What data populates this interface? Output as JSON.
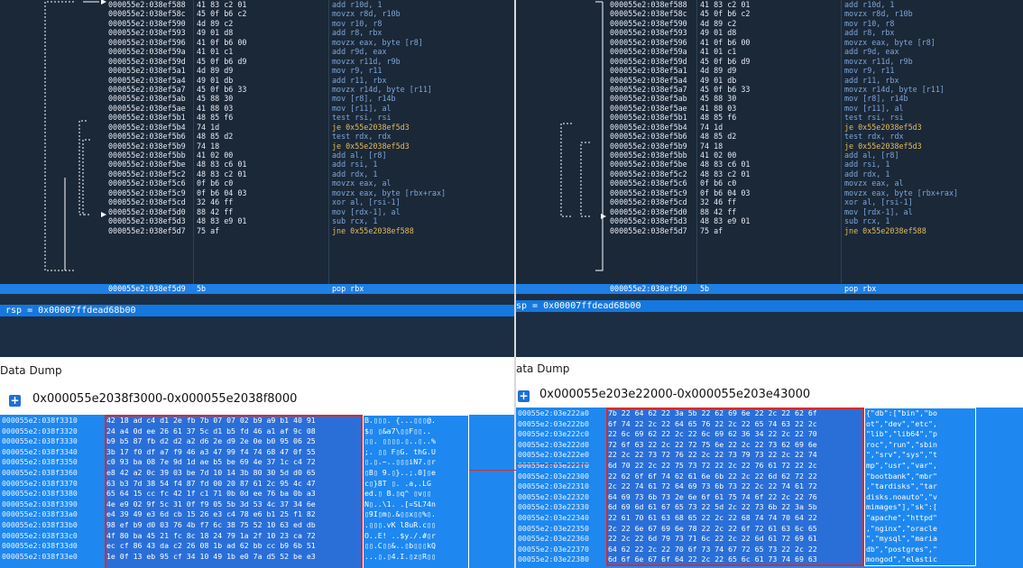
{
  "left": {
    "disasm": {
      "addresses": [
        "000055e2:038ef588",
        "000055e2:038ef58c",
        "000055e2:038ef590",
        "000055e2:038ef593",
        "000055e2:038ef596",
        "000055e2:038ef59a",
        "000055e2:038ef59d",
        "000055e2:038ef5a1",
        "000055e2:038ef5a4",
        "000055e2:038ef5a7",
        "000055e2:038ef5ab",
        "000055e2:038ef5ae",
        "000055e2:038ef5b1",
        "000055e2:038ef5b4",
        "000055e2:038ef5b6",
        "000055e2:038ef5b9",
        "000055e2:038ef5bb",
        "000055e2:038ef5be",
        "000055e2:038ef5c2",
        "000055e2:038ef5c6",
        "000055e2:038ef5c9",
        "000055e2:038ef5cd",
        "000055e2:038ef5d0",
        "000055e2:038ef5d3",
        "000055e2:038ef5d7"
      ],
      "bytes": [
        "41 83 c2 01",
        "45 0f b6 c2",
        "4d 89 c2",
        "49 01 d8",
        "41 0f b6 00",
        "41 01 c1",
        "45 0f b6 d9",
        "4d 89 d9",
        "49 01 db",
        "45 0f b6 33",
        "45 88 30",
        "41 88 03",
        "48 85 f6",
        "74 1d",
        "48 85 d2",
        "74 18",
        "41 02 00",
        "48 83 c6 01",
        "48 83 c2 01",
        "0f b6 c0",
        "0f b6 04 03",
        "32 46 ff",
        "88 42 ff",
        "48 83 e9 01",
        "75 af"
      ],
      "instructions": [
        "add r10d, 1",
        "movzx r8d, r10b",
        "mov r10, r8",
        "add r8, rbx",
        "movzx eax, byte [r8]",
        "add r9d, eax",
        "movzx r11d, r9b",
        "mov r9, r11",
        "add r11, rbx",
        "movzx r14d, byte [r11]",
        "mov [r8], r14b",
        "mov [r11], al",
        "test rsi, rsi",
        "je 0x55e2038ef5d3",
        "test rdx, rdx",
        "je 0x55e2038ef5d3",
        "add al, [r8]",
        "add rsi, 1",
        "add rdx, 1",
        "movzx eax, al",
        "movzx eax, byte [rbx+rax]",
        "xor al, [rsi-1]",
        "mov [rdx-1], al",
        "sub rcx, 1",
        "jne 0x55e2038ef588"
      ],
      "current": {
        "address": "000055e2:038ef5d9",
        "bytes": "5b",
        "instruction": "pop rbx"
      }
    },
    "register": "rsp = 0x00007ffdead68b00",
    "dump_title": "Data Dump",
    "range": "0x000055e2038f3000-0x000055e2038f8000",
    "hex": [
      {
        "addr": "000055e2:038f3310",
        "bytes": "42 18 ad c4 d1 2e fb 7b 07 07 02 b9 a9 b1 40 91",
        "ascii": "B.▯▯▯. {...▯▯▯@."
      },
      {
        "addr": "000055e2:038f3320",
        "bytes": "24 a4 0d ee 26 61 37 5c d1 b5 fd 46 a1 af 9c 08",
        "ascii": "$▯ ▯&a7\\▯▯F▯▯.."
      },
      {
        "addr": "000055e2:038f3330",
        "bytes": "b9 b5 87 fb d2 d2 a2 d6 2e d9 2e 0e b0 95 06 25",
        "ascii": "▯▯. ▯▯▯▯.▯..▯..%"
      },
      {
        "addr": "000055e2:038f3340",
        "bytes": "3b 17 f0 df a7 f9 46 a3 47 99 f4 74 68 47 0f 55",
        "ascii": ";. ▯▯ F▯G. thG.U"
      },
      {
        "addr": "000055e2:038f3350",
        "bytes": "c0 93 ba 08 7e 9d 1d ae b5 be 69 4e 37 1c c4 72",
        "ascii": "▯.▯.~..▯▯▯iN7.▯r"
      },
      {
        "addr": "000055e2:038f3360",
        "bytes": "e8 42 a2 0c 39 03 be 7d 10 14 3b 80 30 5d d0 65",
        "ascii": "▯B▯ 9.▯}..;.0]▯e"
      },
      {
        "addr": "000055e2:038f3370",
        "bytes": "63 b3 7d 38 54 f4 87 fd 00 20 87 61 2c 95 4c 47",
        "ascii": "c▯}8T ▯. .a,.LG"
      },
      {
        "addr": "000055e2:038f3380",
        "bytes": "65 64 15 cc fc 42 1f c1 71 0b 0d ee 76 ba 0b a3",
        "ascii": "ed.▯ B.▯q^ ▯v▯▯"
      },
      {
        "addr": "000055e2:038f3390",
        "bytes": "4e e9 02 9f 5c 31 0f f9 05 5b 3d 53 4c 37 34 6e",
        "ascii": "N▯..\\1. .[=SL74n"
      },
      {
        "addr": "000055e2:038f33a0",
        "bytes": "e4 39 49 e3 6d cb 15 26 e3 c4 78 e6 b1 25 f1 82",
        "ascii": "▯9I▯m▯.&▯▯x▯▯%▯."
      },
      {
        "addr": "000055e2:038f33b0",
        "bytes": "98 ef b9 d0 03 76 4b f7 6c 38 75 52 10 63 ed db",
        "ascii": ".▯▯▯.vK l8uR.c▯▯"
      },
      {
        "addr": "000055e2:038f33c0",
        "bytes": "4f 80 ba 45 21 fc 8c 18 24 79 1a 2f 10 23 ca 72",
        "ascii": "O..E! ..$y./.#▯r"
      },
      {
        "addr": "000055e2:038f33d0",
        "bytes": "ec cf 86 43 da c2 26 08 1b ad 62 bb cc b9 6b 51",
        "ascii": "▯▯.C▯▯&..▯b▯▯▯kQ"
      },
      {
        "addr": "000055e2:038f33e0",
        "bytes": "1e 0f 13 eb 95 cf 34 10 49 1b e0 7a d5 52 be e3",
        "ascii": "...▯.▯4.I.▯z▯R▯▯"
      }
    ]
  },
  "right": {
    "disasm": {
      "addresses": [
        "000055e2:038ef588",
        "000055e2:038ef58c",
        "000055e2:038ef590",
        "000055e2:038ef593",
        "000055e2:038ef596",
        "000055e2:038ef59a",
        "000055e2:038ef59d",
        "000055e2:038ef5a1",
        "000055e2:038ef5a4",
        "000055e2:038ef5a7",
        "000055e2:038ef5ab",
        "000055e2:038ef5ae",
        "000055e2:038ef5b1",
        "000055e2:038ef5b4",
        "000055e2:038ef5b6",
        "000055e2:038ef5b9",
        "000055e2:038ef5bb",
        "000055e2:038ef5be",
        "000055e2:038ef5c2",
        "000055e2:038ef5c6",
        "000055e2:038ef5c9",
        "000055e2:038ef5cd",
        "000055e2:038ef5d0",
        "000055e2:038ef5d3",
        "000055e2:038ef5d7"
      ],
      "bytes": [
        "41 83 c2 01",
        "45 0f b6 c2",
        "4d 89 c2",
        "49 01 d8",
        "41 0f b6 00",
        "41 01 c1",
        "45 0f b6 d9",
        "4d 89 d9",
        "49 01 db",
        "45 0f b6 33",
        "45 88 30",
        "41 88 03",
        "48 85 f6",
        "74 1d",
        "48 85 d2",
        "74 18",
        "41 02 00",
        "48 83 c6 01",
        "48 83 c2 01",
        "0f b6 c0",
        "0f b6 04 03",
        "32 46 ff",
        "88 42 ff",
        "48 83 e9 01",
        "75 af"
      ],
      "instructions": [
        "add r10d, 1",
        "movzx r8d, r10b",
        "mov r10, r8",
        "add r8, rbx",
        "movzx eax, byte [r8]",
        "add r9d, eax",
        "movzx r11d, r9b",
        "mov r9, r11",
        "add r11, rbx",
        "movzx r14d, byte [r11]",
        "mov [r8], r14b",
        "mov [r11], al",
        "test rsi, rsi",
        "je 0x55e2038ef5d3",
        "test rdx, rdx",
        "je 0x55e2038ef5d3",
        "add al, [r8]",
        "add rsi, 1",
        "add rdx, 1",
        "movzx eax, al",
        "movzx eax, byte [rbx+rax]",
        "xor al, [rsi-1]",
        "mov [rdx-1], al",
        "sub rcx, 1",
        "jne 0x55e2038ef588"
      ],
      "current": {
        "address": "000055e2:038ef5d9",
        "bytes": "5b",
        "instruction": "pop rbx"
      }
    },
    "register": "sp = 0x00007ffdead68b00",
    "dump_title": "ata Dump",
    "range": "0x000055e203e22000-0x000055e203e43000",
    "hex": [
      {
        "addr": "00055e2:03e222a0",
        "bytes": "7b 22 64 62 22 3a 5b 22 62 69 6e 22 2c 22 62 6f",
        "ascii": "{\"db\":[\"bin\",\"bo"
      },
      {
        "addr": "00055e2:03e222b0",
        "bytes": "6f 74 22 2c 22 64 65 76 22 2c 22 65 74 63 22 2c",
        "ascii": "ot\",\"dev\",\"etc\","
      },
      {
        "addr": "00055e2:03e222c0",
        "bytes": "22 6c 69 62 22 2c 22 6c 69 62 36 34 22 2c 22 70",
        "ascii": "\"lib\",\"lib64\",\"p"
      },
      {
        "addr": "00055e2:03e222d0",
        "bytes": "72 6f 63 22 2c 22 72 75 6e 22 2c 22 73 62 69 6e",
        "ascii": "roc\",\"run\",\"sbin"
      },
      {
        "addr": "00055e2:03e222e0",
        "bytes": "22 2c 22 73 72 76 22 2c 22 73 79 73 22 2c 22 74",
        "ascii": "\",\"srv\",\"sys\",\"t"
      },
      {
        "addr": "00055e2:03e222f0",
        "bytes": "6d 70 22 2c 22 75 73 72 22 2c 22 76 61 72 22 2c",
        "ascii": "mp\",\"usr\",\"var\","
      },
      {
        "addr": "00055e2:03e22300",
        "bytes": "22 62 6f 6f 74 62 61 6e 6b 22 2c 22 6d 62 72 22",
        "ascii": "\"bootbank\",\"mbr\""
      },
      {
        "addr": "00055e2:03e22310",
        "bytes": "2c 22 74 61 72 64 69 73 6b 73 22 2c 22 74 61 72",
        "ascii": ",\"tardisks\",\"tar"
      },
      {
        "addr": "00055e2:03e22320",
        "bytes": "64 69 73 6b 73 2e 6e 6f 61 75 74 6f 22 2c 22 76",
        "ascii": "disks.noauto\",\"v"
      },
      {
        "addr": "00055e2:03e22330",
        "bytes": "6d 69 6d 61 67 65 73 22 5d 2c 22 73 6b 22 3a 5b",
        "ascii": "mimages\"],\"sk\":["
      },
      {
        "addr": "00055e2:03e22340",
        "bytes": "22 61 70 61 63 68 65 22 2c 22 68 74 74 70 64 22",
        "ascii": "\"apache\",\"httpd\""
      },
      {
        "addr": "00055e2:03e22350",
        "bytes": "2c 22 6e 67 69 6e 78 22 2c 22 6f 72 61 63 6c 65",
        "ascii": ",\"nginx\",\"oracle"
      },
      {
        "addr": "00055e2:03e22360",
        "bytes": "22 2c 22 6d 79 73 71 6c 22 2c 22 6d 61 72 69 61",
        "ascii": "\",\"mysql\",\"maria"
      },
      {
        "addr": "00055e2:03e22370",
        "bytes": "64 62 22 2c 22 70 6f 73 74 67 72 65 73 22 2c 22",
        "ascii": "db\",\"postgres\",\""
      },
      {
        "addr": "00055e2:03e22380",
        "bytes": "6d 6f 6e 67 6f 64 22 2c 22 65 6c 61 73 74 69 63",
        "ascii": "mongod\",\"elastic"
      }
    ]
  }
}
